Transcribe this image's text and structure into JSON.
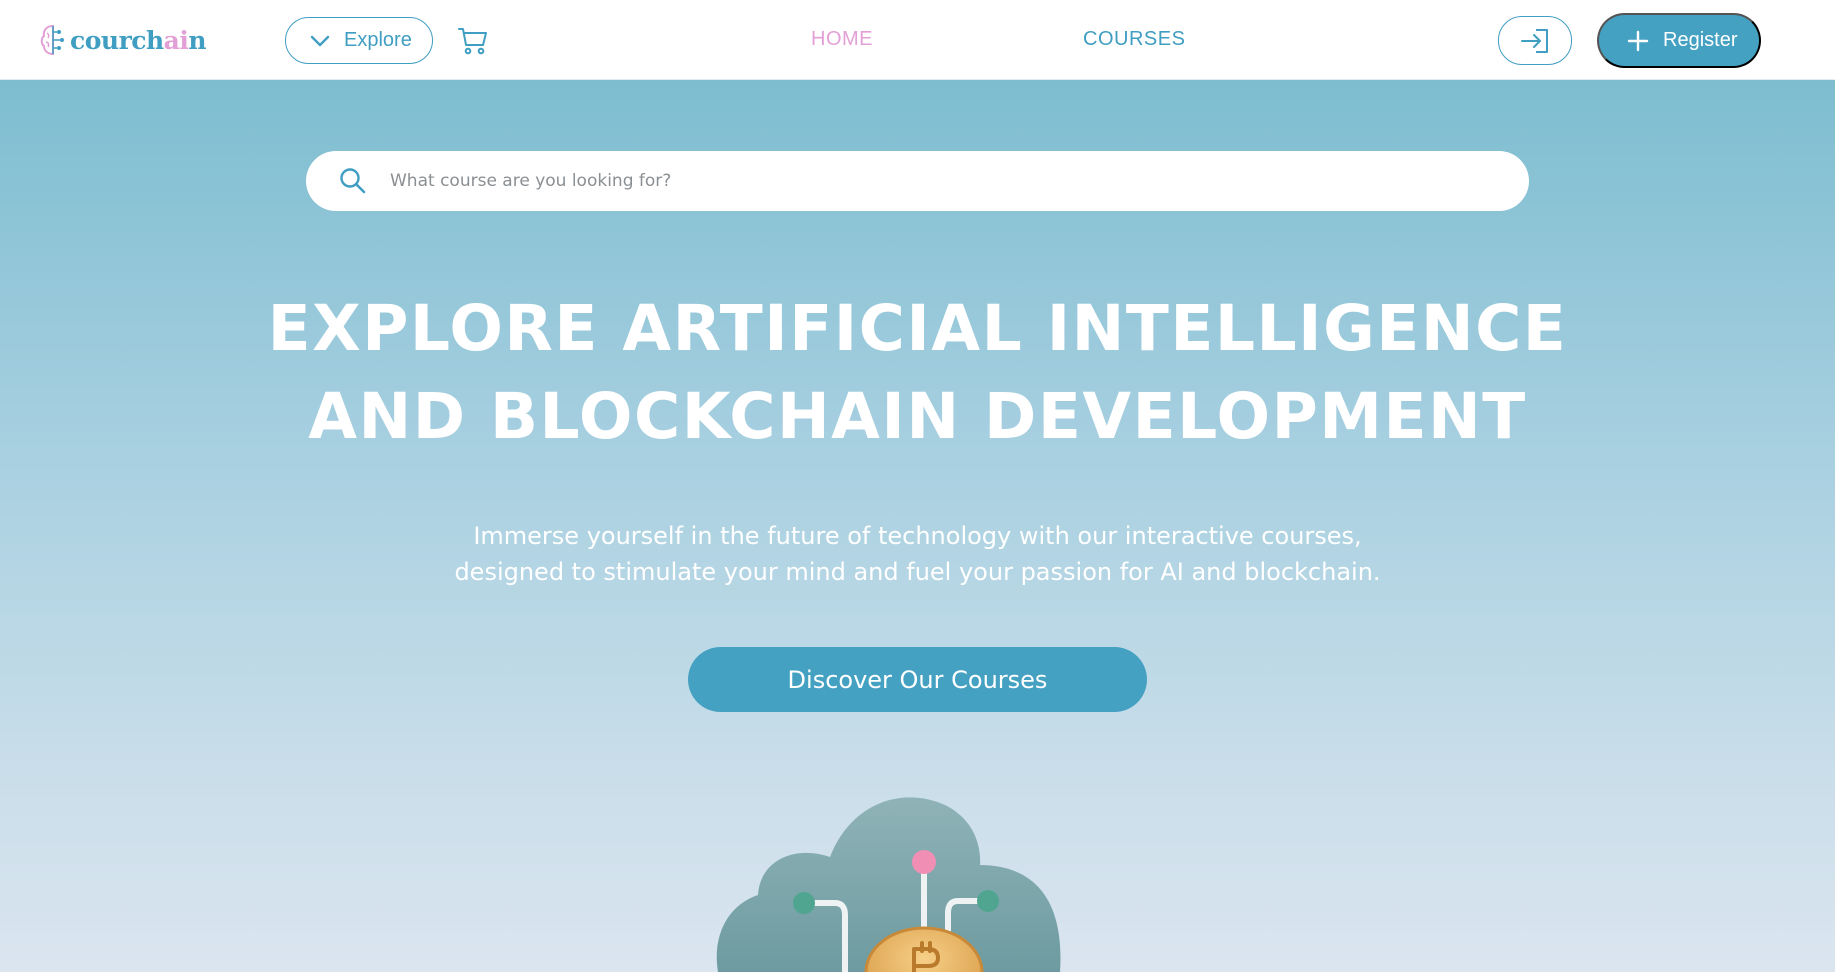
{
  "navbar": {
    "logo": {
      "prefix": "courch",
      "accent": "ai",
      "suffix": "n"
    },
    "explore_label": "Explore",
    "links": {
      "home": "HOME",
      "courses": "COURSES"
    },
    "register_label": "Register"
  },
  "search": {
    "placeholder": "What course are you looking for?"
  },
  "hero": {
    "title_line1": "EXPLORE ARTIFICIAL INTELLIGENCE",
    "title_line2": "AND BLOCKCHAIN DEVELOPMENT",
    "subtitle_line1": "Immerse yourself in the future of technology with our interactive courses,",
    "subtitle_line2": "designed to stimulate your mind and fuel your passion for AI and blockchain.",
    "cta_label": "Discover Our Courses"
  },
  "icons": {
    "logo": "brain-circuit-icon",
    "explore": "chevron-down-icon",
    "cart": "cart-icon",
    "login": "login-icon",
    "register": "plus-icon",
    "search": "search-icon"
  },
  "colors": {
    "primary": "#45a1c2",
    "accent_pink": "#e3a0d6",
    "hero_top": "#7dbdd0",
    "hero_bottom": "#dbe5f0"
  }
}
